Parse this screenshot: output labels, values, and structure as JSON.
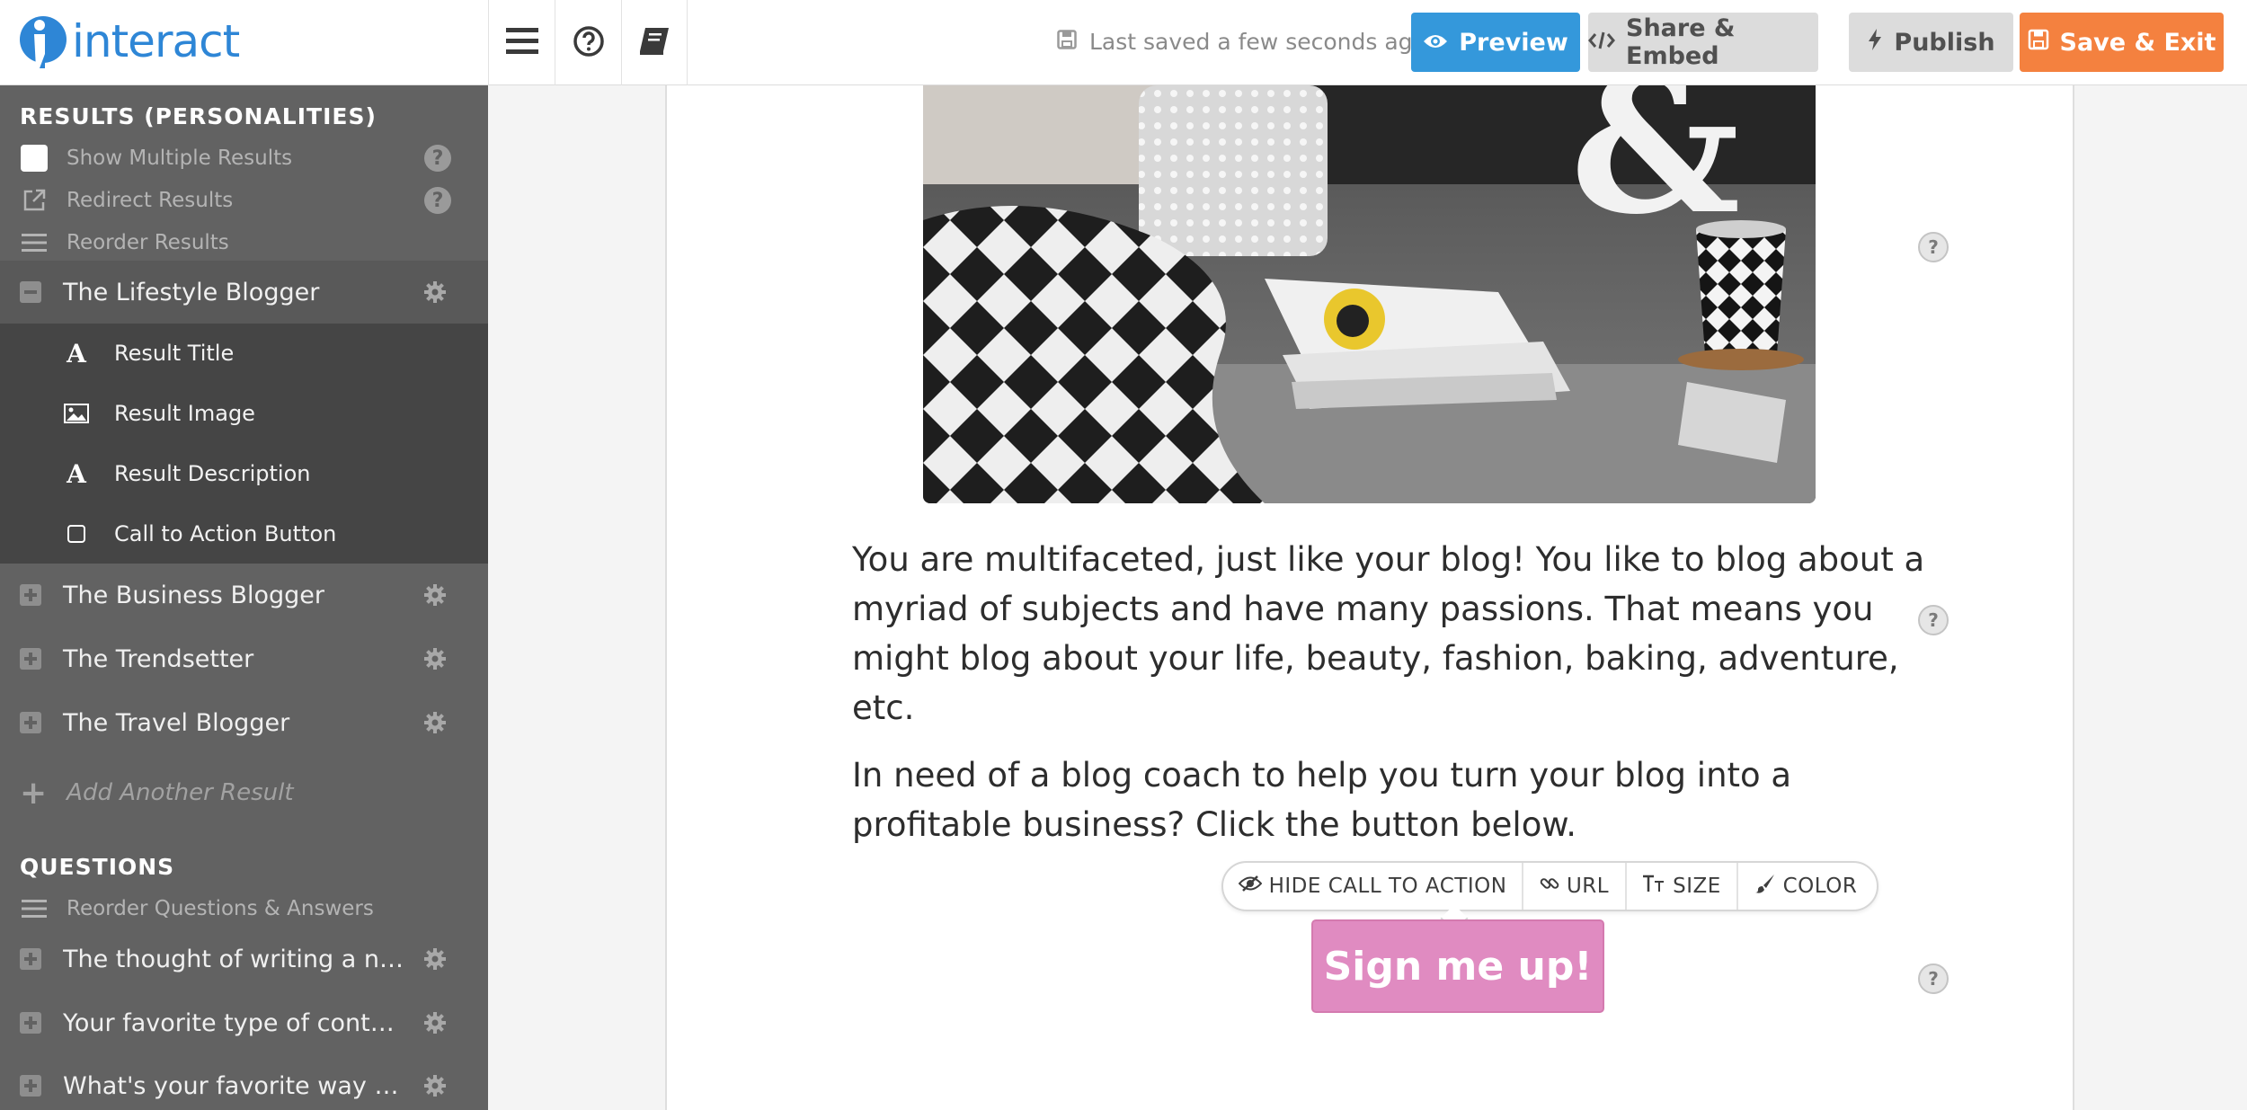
{
  "app": {
    "logo_text": "interact"
  },
  "toolbar": {
    "last_saved": "Last saved a few seconds ago",
    "preview_label": "Preview",
    "share_label": "Share & Embed",
    "publish_label": "Publish",
    "save_exit_label": "Save & Exit"
  },
  "sidebar": {
    "results_heading": "RESULTS (PERSONALITIES)",
    "options": {
      "show_multiple": "Show Multiple Results",
      "redirect": "Redirect Results",
      "reorder": "Reorder Results"
    },
    "results": [
      {
        "label": "The Lifestyle Blogger"
      },
      {
        "label": "The Business Blogger"
      },
      {
        "label": "The Trendsetter"
      },
      {
        "label": "The Travel Blogger"
      }
    ],
    "sub_items": {
      "title": "Result Title",
      "image": "Result Image",
      "description": "Result Description",
      "cta": "Call to Action Button"
    },
    "add_result": "Add Another Result",
    "questions_heading": "QUESTIONS",
    "reorder_questions": "Reorder Questions & Answers",
    "questions": [
      {
        "label": "The thought of writing a new ..."
      },
      {
        "label": "Your favorite type of content is:"
      },
      {
        "label": "What's your favorite way to sh..."
      }
    ]
  },
  "canvas": {
    "description_p1": "You are multifaceted, just like your blog! You like to blog about a myriad of subjects and have many passions. That means you might blog about your life, beauty, fashion, baking, adventure, etc.",
    "description_p2": "In need of a blog coach to help you turn your blog into a profitable business? Click the button below.",
    "cta_toolbar": {
      "hide": "HIDE CALL TO ACTION",
      "url": "URL",
      "size": "SIZE",
      "color": "COLOR"
    },
    "cta_button": "Sign me up!",
    "help_glyph": "?"
  },
  "colors": {
    "brand_blue": "#2e86d6",
    "preview_blue": "#3498db",
    "save_orange": "#f4813f",
    "sidebar_bg": "#626262",
    "cta_pink": "#e08bc1"
  }
}
